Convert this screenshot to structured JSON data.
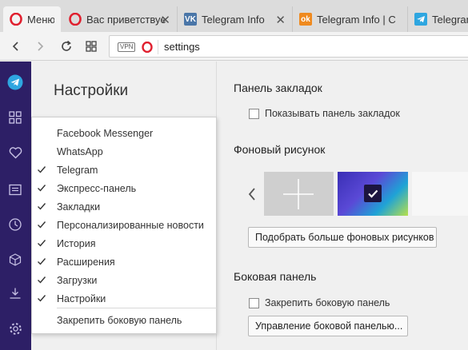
{
  "tabs": [
    {
      "label": "Меню",
      "favicon": "opera-icon",
      "active": true
    },
    {
      "label": "Вас приветствуе",
      "favicon": "opera-icon"
    },
    {
      "label": "Telegram Info",
      "favicon": "vk-icon"
    },
    {
      "label": "Telegram Info | С",
      "favicon": "odnoklassniki-icon"
    },
    {
      "label": "Telegram",
      "favicon": "telegram-icon"
    }
  ],
  "address": {
    "vpn_badge": "VPN",
    "url": "settings"
  },
  "settings": {
    "title": "Настройки"
  },
  "popup": {
    "items": [
      {
        "label": "Facebook Messenger",
        "checked": false
      },
      {
        "label": "WhatsApp",
        "checked": false
      },
      {
        "label": "Telegram",
        "checked": true
      },
      {
        "label": "Экспресс-панель",
        "checked": true
      },
      {
        "label": "Закладки",
        "checked": true
      },
      {
        "label": "Персонализированные новости",
        "checked": true
      },
      {
        "label": "История",
        "checked": true
      },
      {
        "label": "Расширения",
        "checked": true
      },
      {
        "label": "Загрузки",
        "checked": true
      },
      {
        "label": "Настройки",
        "checked": true
      }
    ],
    "pin_label": "Закрепить боковую панель"
  },
  "bookmarks_panel": {
    "heading": "Панель закладок",
    "checkbox_label": "Показывать панель закладок",
    "checked": false
  },
  "wallpaper": {
    "heading": "Фоновый рисунок",
    "more_button": "Подобрать больше фоновых рисунков"
  },
  "sidebar_panel": {
    "heading": "Боковая панель",
    "checkbox_label": "Закрепить боковую панель",
    "checked": false,
    "manage_button": "Управление боковой панелью..."
  },
  "colors": {
    "sidebar": "#2d1f66",
    "opera_red": "#e0202f",
    "telegram_blue": "#2ea6e0",
    "vk_blue": "#4a76a8",
    "ok_orange": "#ef8a1f"
  }
}
